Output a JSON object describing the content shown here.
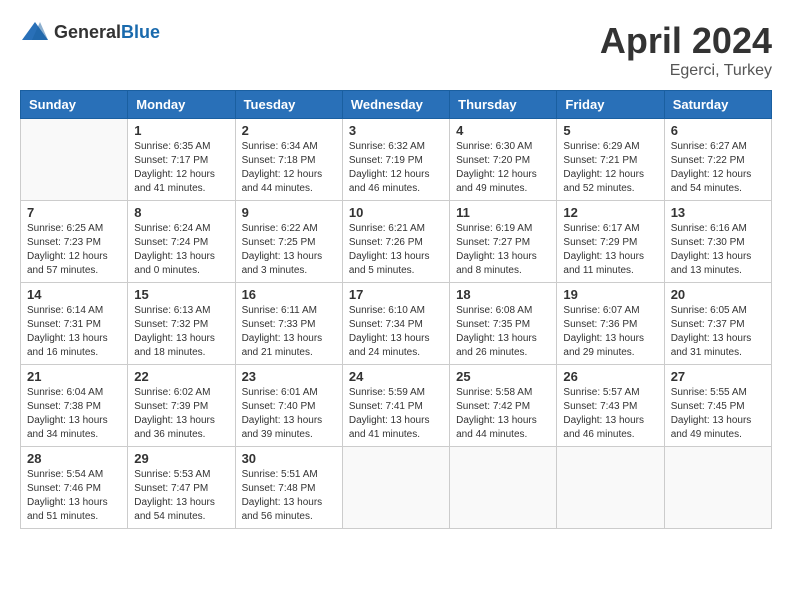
{
  "header": {
    "logo_general": "General",
    "logo_blue": "Blue",
    "title": "April 2024",
    "subtitle": "Egerci, Turkey"
  },
  "calendar": {
    "days_of_week": [
      "Sunday",
      "Monday",
      "Tuesday",
      "Wednesday",
      "Thursday",
      "Friday",
      "Saturday"
    ],
    "weeks": [
      [
        {
          "day": "",
          "info": ""
        },
        {
          "day": "1",
          "info": "Sunrise: 6:35 AM\nSunset: 7:17 PM\nDaylight: 12 hours\nand 41 minutes."
        },
        {
          "day": "2",
          "info": "Sunrise: 6:34 AM\nSunset: 7:18 PM\nDaylight: 12 hours\nand 44 minutes."
        },
        {
          "day": "3",
          "info": "Sunrise: 6:32 AM\nSunset: 7:19 PM\nDaylight: 12 hours\nand 46 minutes."
        },
        {
          "day": "4",
          "info": "Sunrise: 6:30 AM\nSunset: 7:20 PM\nDaylight: 12 hours\nand 49 minutes."
        },
        {
          "day": "5",
          "info": "Sunrise: 6:29 AM\nSunset: 7:21 PM\nDaylight: 12 hours\nand 52 minutes."
        },
        {
          "day": "6",
          "info": "Sunrise: 6:27 AM\nSunset: 7:22 PM\nDaylight: 12 hours\nand 54 minutes."
        }
      ],
      [
        {
          "day": "7",
          "info": "Sunrise: 6:25 AM\nSunset: 7:23 PM\nDaylight: 12 hours\nand 57 minutes."
        },
        {
          "day": "8",
          "info": "Sunrise: 6:24 AM\nSunset: 7:24 PM\nDaylight: 13 hours\nand 0 minutes."
        },
        {
          "day": "9",
          "info": "Sunrise: 6:22 AM\nSunset: 7:25 PM\nDaylight: 13 hours\nand 3 minutes."
        },
        {
          "day": "10",
          "info": "Sunrise: 6:21 AM\nSunset: 7:26 PM\nDaylight: 13 hours\nand 5 minutes."
        },
        {
          "day": "11",
          "info": "Sunrise: 6:19 AM\nSunset: 7:27 PM\nDaylight: 13 hours\nand 8 minutes."
        },
        {
          "day": "12",
          "info": "Sunrise: 6:17 AM\nSunset: 7:29 PM\nDaylight: 13 hours\nand 11 minutes."
        },
        {
          "day": "13",
          "info": "Sunrise: 6:16 AM\nSunset: 7:30 PM\nDaylight: 13 hours\nand 13 minutes."
        }
      ],
      [
        {
          "day": "14",
          "info": "Sunrise: 6:14 AM\nSunset: 7:31 PM\nDaylight: 13 hours\nand 16 minutes."
        },
        {
          "day": "15",
          "info": "Sunrise: 6:13 AM\nSunset: 7:32 PM\nDaylight: 13 hours\nand 18 minutes."
        },
        {
          "day": "16",
          "info": "Sunrise: 6:11 AM\nSunset: 7:33 PM\nDaylight: 13 hours\nand 21 minutes."
        },
        {
          "day": "17",
          "info": "Sunrise: 6:10 AM\nSunset: 7:34 PM\nDaylight: 13 hours\nand 24 minutes."
        },
        {
          "day": "18",
          "info": "Sunrise: 6:08 AM\nSunset: 7:35 PM\nDaylight: 13 hours\nand 26 minutes."
        },
        {
          "day": "19",
          "info": "Sunrise: 6:07 AM\nSunset: 7:36 PM\nDaylight: 13 hours\nand 29 minutes."
        },
        {
          "day": "20",
          "info": "Sunrise: 6:05 AM\nSunset: 7:37 PM\nDaylight: 13 hours\nand 31 minutes."
        }
      ],
      [
        {
          "day": "21",
          "info": "Sunrise: 6:04 AM\nSunset: 7:38 PM\nDaylight: 13 hours\nand 34 minutes."
        },
        {
          "day": "22",
          "info": "Sunrise: 6:02 AM\nSunset: 7:39 PM\nDaylight: 13 hours\nand 36 minutes."
        },
        {
          "day": "23",
          "info": "Sunrise: 6:01 AM\nSunset: 7:40 PM\nDaylight: 13 hours\nand 39 minutes."
        },
        {
          "day": "24",
          "info": "Sunrise: 5:59 AM\nSunset: 7:41 PM\nDaylight: 13 hours\nand 41 minutes."
        },
        {
          "day": "25",
          "info": "Sunrise: 5:58 AM\nSunset: 7:42 PM\nDaylight: 13 hours\nand 44 minutes."
        },
        {
          "day": "26",
          "info": "Sunrise: 5:57 AM\nSunset: 7:43 PM\nDaylight: 13 hours\nand 46 minutes."
        },
        {
          "day": "27",
          "info": "Sunrise: 5:55 AM\nSunset: 7:45 PM\nDaylight: 13 hours\nand 49 minutes."
        }
      ],
      [
        {
          "day": "28",
          "info": "Sunrise: 5:54 AM\nSunset: 7:46 PM\nDaylight: 13 hours\nand 51 minutes."
        },
        {
          "day": "29",
          "info": "Sunrise: 5:53 AM\nSunset: 7:47 PM\nDaylight: 13 hours\nand 54 minutes."
        },
        {
          "day": "30",
          "info": "Sunrise: 5:51 AM\nSunset: 7:48 PM\nDaylight: 13 hours\nand 56 minutes."
        },
        {
          "day": "",
          "info": ""
        },
        {
          "day": "",
          "info": ""
        },
        {
          "day": "",
          "info": ""
        },
        {
          "day": "",
          "info": ""
        }
      ]
    ]
  }
}
